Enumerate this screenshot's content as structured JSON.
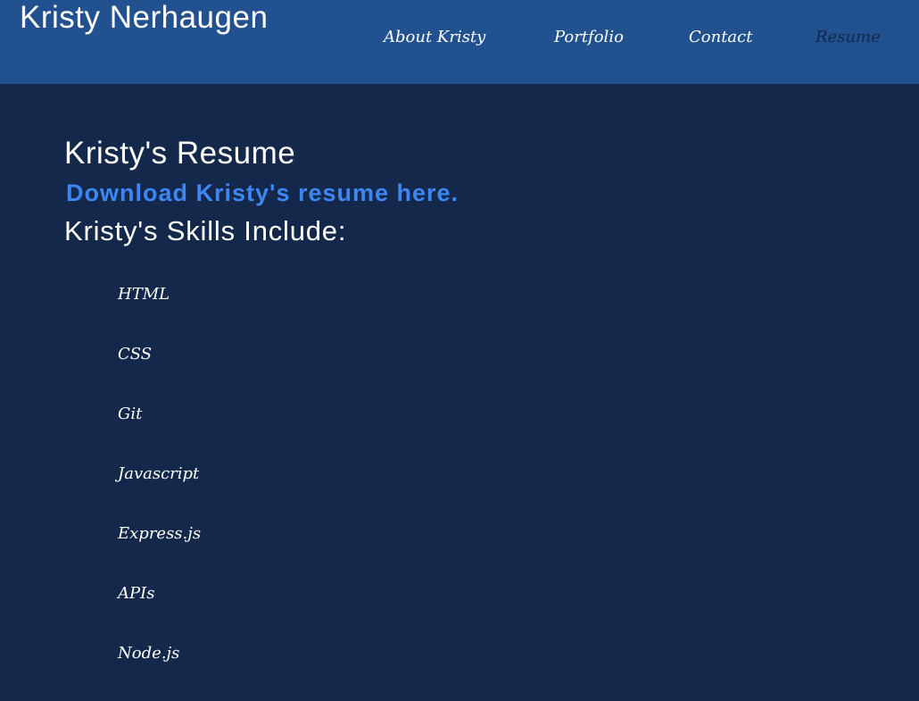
{
  "header": {
    "site_title": "Kristy Nerhaugen",
    "nav": [
      {
        "label": "About Kristy",
        "active": false
      },
      {
        "label": "Portfolio",
        "active": false
      },
      {
        "label": "Contact",
        "active": false
      },
      {
        "label": "Resume",
        "active": true
      }
    ]
  },
  "main": {
    "heading": "Kristy's Resume",
    "download_link": "Download Kristy's resume here.",
    "skills_heading": "Kristy's Skills Include:",
    "skills": [
      "HTML",
      "CSS",
      "Git",
      "Javascript",
      "Express.js",
      "APIs",
      "Node.js"
    ]
  },
  "colors": {
    "header_bg": "#22518f",
    "page_bg": "#13284a",
    "link_accent": "#3e87f2",
    "active_nav": "#13284a",
    "text": "#ffffff"
  }
}
